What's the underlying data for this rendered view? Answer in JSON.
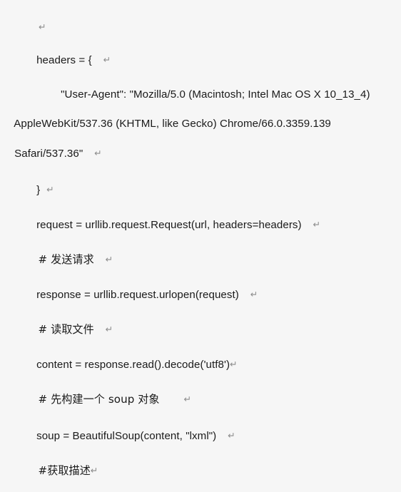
{
  "document": {
    "background_color": "#f6f6f6",
    "text_color": "#1a1a1a",
    "return_mark_color": "#8c8c8c",
    "return_mark_glyph": "↵",
    "lines": [
      {
        "id": "line-blank-top",
        "text": "",
        "indent": 0,
        "has_return_mark": true
      },
      {
        "id": "line-headers-open",
        "text": "headers = {",
        "indent": 1,
        "has_return_mark": true
      },
      {
        "id": "line-user-agent-1",
        "text": "\"User-Agent\": \"Mozilla/5.0 (Macintosh; Intel Mac OS X 10_13_4)",
        "indent": 2,
        "has_return_mark": false
      },
      {
        "id": "line-user-agent-2",
        "text": "AppleWebKit/537.36 (KHTML, like Gecko) Chrome/66.0.3359.139",
        "indent": 0,
        "has_return_mark": false
      },
      {
        "id": "line-user-agent-3",
        "text": "Safari/537.36\"",
        "indent": 0,
        "has_return_mark": true
      },
      {
        "id": "line-headers-close",
        "text": "}",
        "indent": 1,
        "has_return_mark": true
      },
      {
        "id": "line-request",
        "text": "request = urllib.request.Request(url, headers=headers)",
        "indent": 1,
        "has_return_mark": true
      },
      {
        "id": "line-comment-send-request",
        "text": "# 发送请求",
        "indent": 1,
        "has_return_mark": true
      },
      {
        "id": "line-response",
        "text": "response = urllib.request.urlopen(request)",
        "indent": 1,
        "has_return_mark": true
      },
      {
        "id": "line-comment-read-file",
        "text": "# 读取文件",
        "indent": 1,
        "has_return_mark": true
      },
      {
        "id": "line-content",
        "text": "content = response.read().decode('utf8')",
        "indent": 1,
        "has_return_mark": true
      },
      {
        "id": "line-comment-build-soup",
        "text": "# 先构建一个 soup 对象",
        "indent": 1,
        "has_return_mark": true
      },
      {
        "id": "line-soup",
        "text": "soup = BeautifulSoup(content, \"lxml\")",
        "indent": 1,
        "has_return_mark": true
      },
      {
        "id": "line-comment-get-description",
        "text": "#获取描述",
        "indent": 1,
        "has_return_mark": true
      }
    ]
  }
}
